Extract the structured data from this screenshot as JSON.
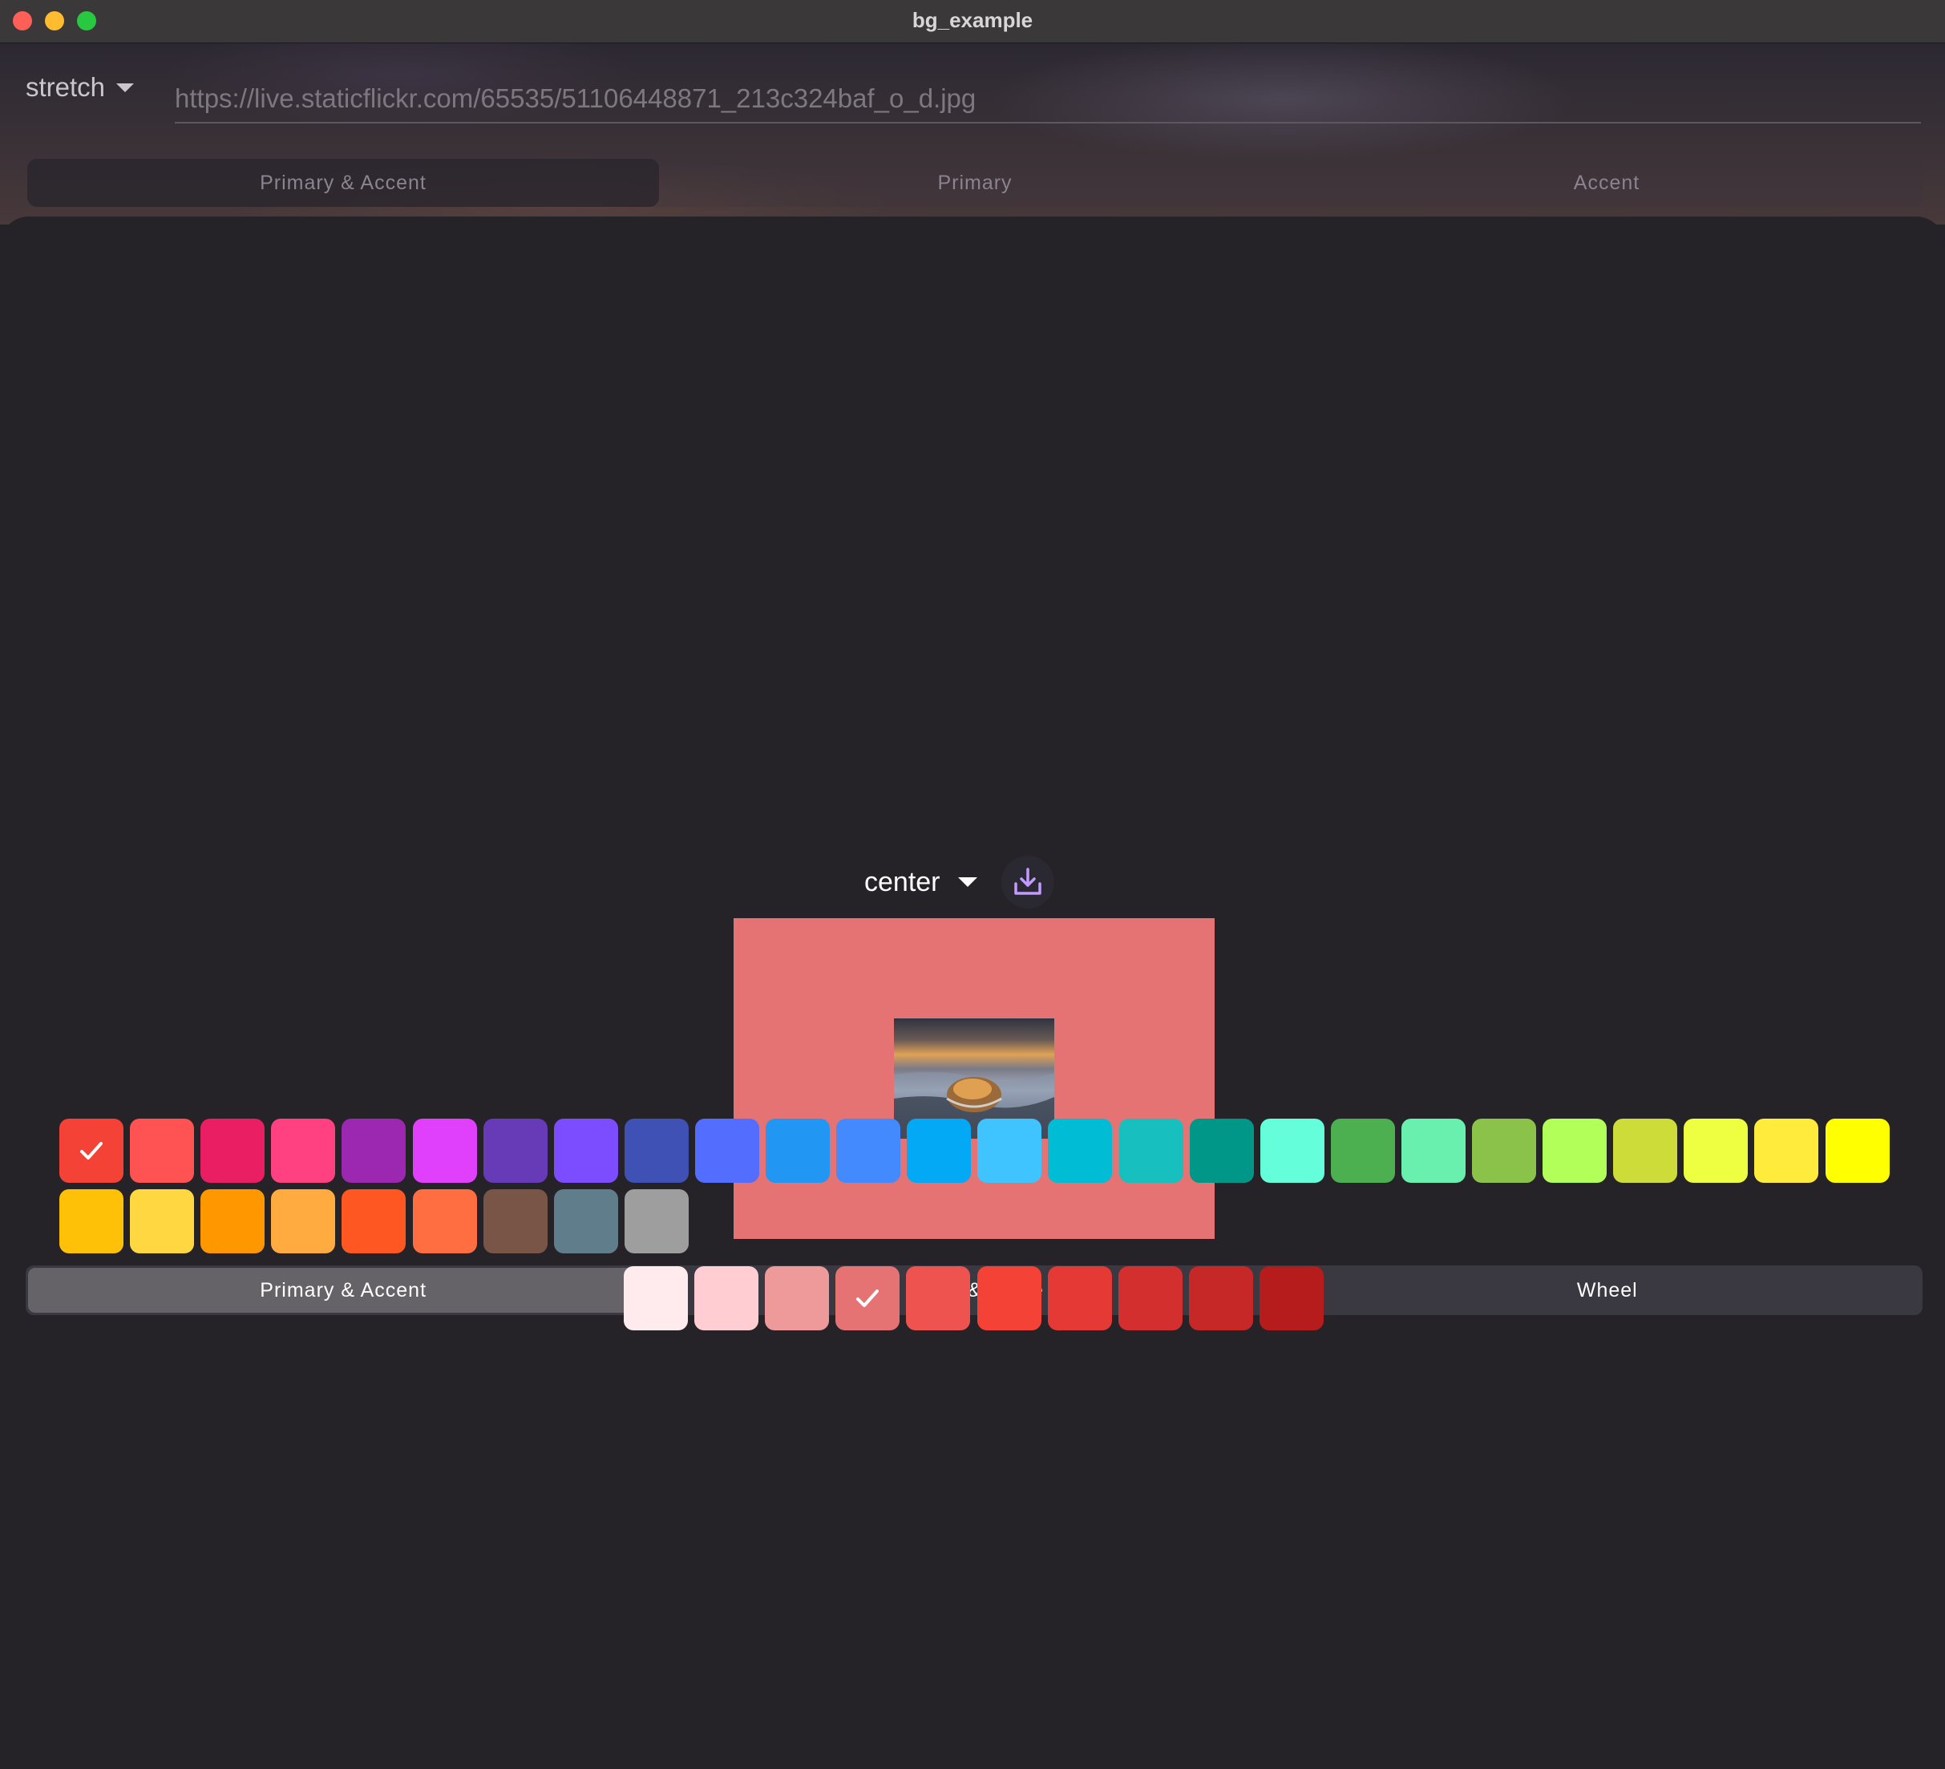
{
  "window": {
    "title": "bg_example"
  },
  "toolbar": {
    "fit_mode": "stretch",
    "url": "https://live.staticflickr.com/65535/51106448871_213c324baf_o_d.jpg"
  },
  "top_tabs": [
    {
      "label": "Primary & Accent",
      "active": true
    },
    {
      "label": "Primary",
      "active": false
    },
    {
      "label": "Accent",
      "active": false
    }
  ],
  "preview": {
    "alignment": "center",
    "background_color": "#e57373"
  },
  "bottom_tabs": [
    {
      "label": "Primary & Accent",
      "active": true
    },
    {
      "label": "Black & White",
      "active": false
    },
    {
      "label": "Wheel",
      "active": false
    }
  ],
  "primary_swatches": [
    {
      "color": "#f44336",
      "selected": true
    },
    {
      "color": "#ff5252",
      "selected": false
    },
    {
      "color": "#e91e63",
      "selected": false
    },
    {
      "color": "#ff4081",
      "selected": false
    },
    {
      "color": "#9c27b0",
      "selected": false
    },
    {
      "color": "#e040fb",
      "selected": false
    },
    {
      "color": "#673ab7",
      "selected": false
    },
    {
      "color": "#7c4dff",
      "selected": false
    },
    {
      "color": "#3f51b5",
      "selected": false
    },
    {
      "color": "#536dfe",
      "selected": false
    },
    {
      "color": "#2196f3",
      "selected": false
    },
    {
      "color": "#448aff",
      "selected": false
    },
    {
      "color": "#03a9f4",
      "selected": false
    },
    {
      "color": "#40c4ff",
      "selected": false
    },
    {
      "color": "#00bcd4",
      "selected": false
    },
    {
      "color": "#18bfbf",
      "selected": false
    },
    {
      "color": "#009688",
      "selected": false
    },
    {
      "color": "#64ffda",
      "selected": false
    },
    {
      "color": "#4caf50",
      "selected": false
    },
    {
      "color": "#69f0ae",
      "selected": false
    },
    {
      "color": "#8bc34a",
      "selected": false
    },
    {
      "color": "#b2ff59",
      "selected": false
    },
    {
      "color": "#cddc39",
      "selected": false
    },
    {
      "color": "#eeff41",
      "selected": false
    },
    {
      "color": "#ffeb3b",
      "selected": false
    },
    {
      "color": "#ffff00",
      "selected": false
    },
    {
      "color": "#ffc107",
      "selected": false
    },
    {
      "color": "#ffd740",
      "selected": false
    },
    {
      "color": "#ff9800",
      "selected": false
    },
    {
      "color": "#ffab40",
      "selected": false
    },
    {
      "color": "#ff5722",
      "selected": false
    },
    {
      "color": "#ff6e40",
      "selected": false
    },
    {
      "color": "#795548",
      "selected": false
    },
    {
      "color": "#607d8b",
      "selected": false
    },
    {
      "color": "#9e9e9e",
      "selected": false
    }
  ],
  "shade_swatches": [
    {
      "color": "#ffebee",
      "selected": false
    },
    {
      "color": "#ffcdd2",
      "selected": false
    },
    {
      "color": "#ef9a9a",
      "selected": false
    },
    {
      "color": "#e57373",
      "selected": true
    },
    {
      "color": "#ef5350",
      "selected": false
    },
    {
      "color": "#f44336",
      "selected": false
    },
    {
      "color": "#e53935",
      "selected": false
    },
    {
      "color": "#d32f2f",
      "selected": false
    },
    {
      "color": "#c62828",
      "selected": false
    },
    {
      "color": "#b71c1c",
      "selected": false
    }
  ],
  "colors": {
    "accent": "#c39bff",
    "tab_active": "#656367"
  }
}
